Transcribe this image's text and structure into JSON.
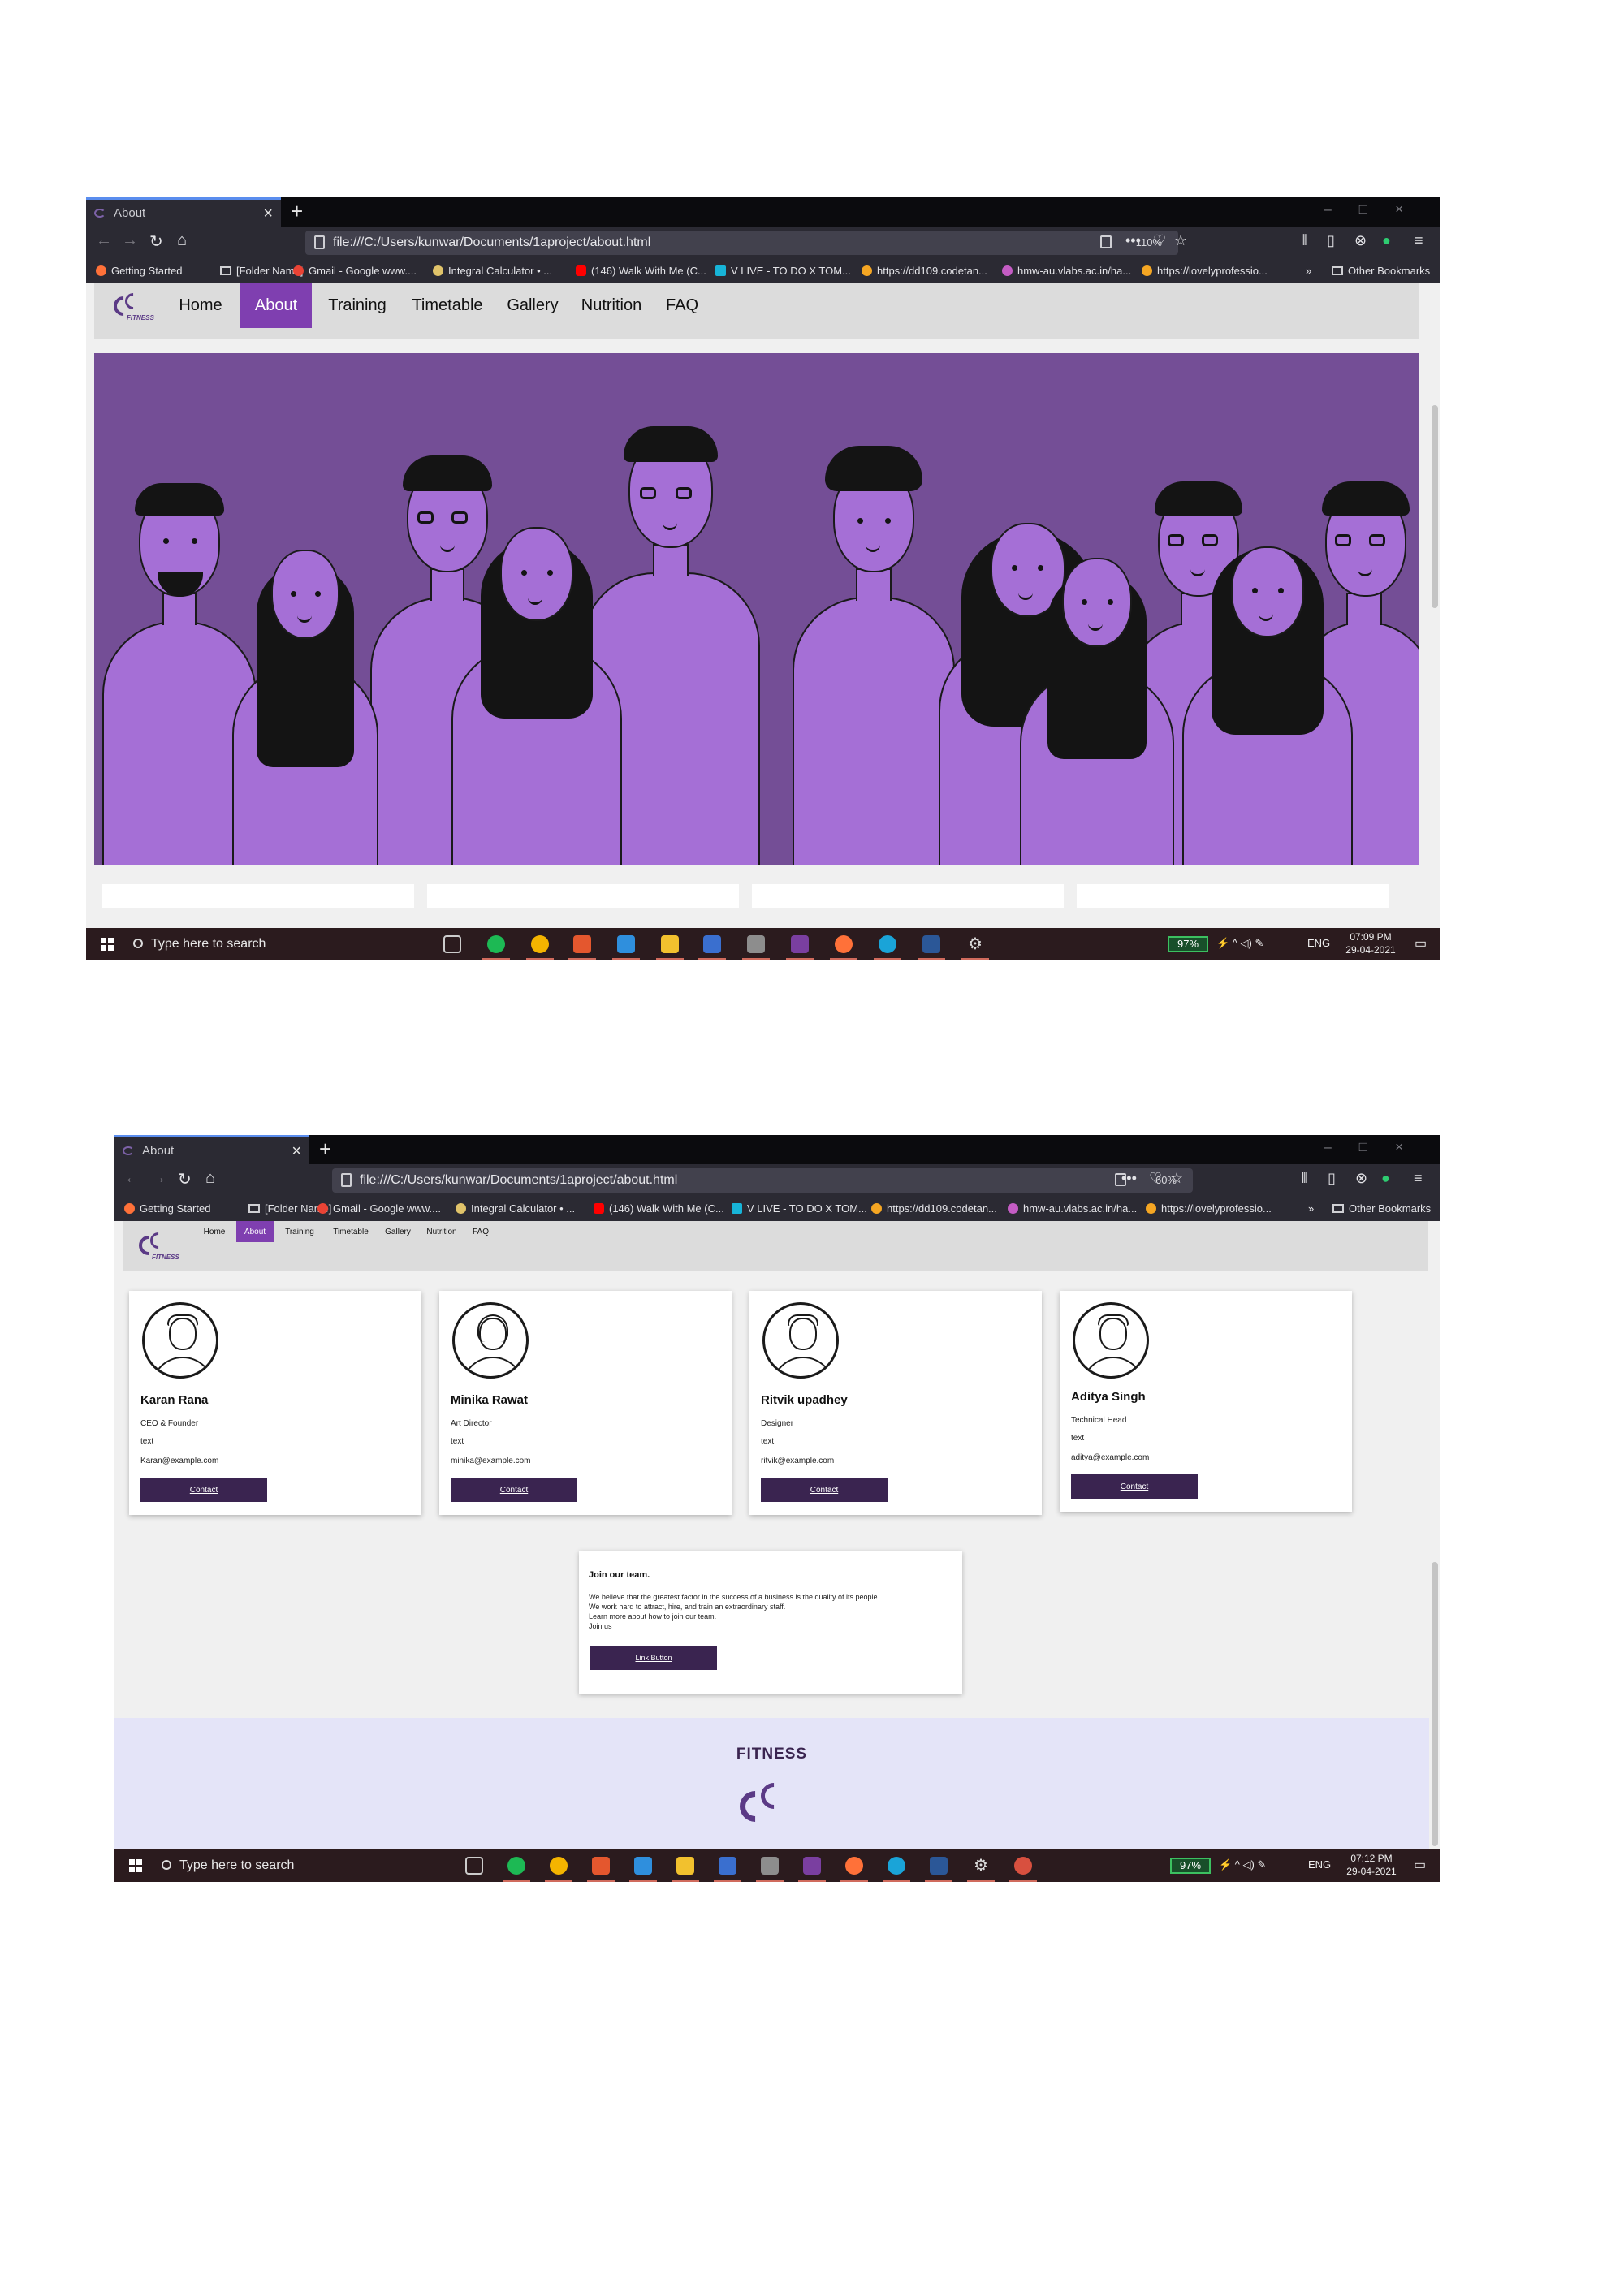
{
  "screens": [
    {
      "tab_title": "About",
      "url": "file:///C:/Users/kunwar/Documents/1aproject/about.html",
      "zoom": "110%",
      "time": "07:09 PM",
      "date": "29-04-2021"
    },
    {
      "tab_title": "About",
      "url": "file:///C:/Users/kunwar/Documents/1aproject/about.html",
      "zoom": "60%",
      "time": "07:12 PM",
      "date": "29-04-2021"
    }
  ],
  "bookmarks": [
    "Getting Started",
    "[Folder Name]",
    "Gmail - Google  www....",
    "Integral Calculator • ...",
    "(146) Walk With Me (C...",
    "V LIVE - TO DO X TOM...",
    "https://dd109.codetan...",
    "hmw-au.vlabs.ac.in/ha...",
    "https://lovelyprofessio...",
    "Other Bookmarks"
  ],
  "site": {
    "logo_text": "FITNESS",
    "nav": [
      "Home",
      "About",
      "Training",
      "Timetable",
      "Gallery",
      "Nutrition",
      "FAQ"
    ],
    "active_nav": "About"
  },
  "team": [
    {
      "name": "Karan Rana",
      "role": "CEO & Founder",
      "text": "text",
      "email": "Karan@example.com",
      "button": "Contact"
    },
    {
      "name": "Minika Rawat",
      "role": "Art Director",
      "text": "text",
      "email": "minika@example.com",
      "button": "Contact"
    },
    {
      "name": "Ritvik upadhey",
      "role": "Designer",
      "text": "text",
      "email": "ritvik@example.com",
      "button": "Contact"
    },
    {
      "name": "Aditya Singh",
      "role": "Technical Head",
      "text": "text",
      "email": "aditya@example.com",
      "button": "Contact"
    }
  ],
  "join": {
    "title": "Join our team.",
    "lines": [
      "We believe that the greatest factor in the success of a business is the quality of its people.",
      "We work hard to attract, hire, and train an extraordinary staff.",
      "Learn more about how to join our team.",
      "Join us"
    ],
    "button": "Link Button"
  },
  "footer": {
    "title": "FITNESS"
  },
  "taskbar": {
    "search_placeholder": "Type here to search",
    "battery": "97%",
    "lang": "ENG"
  },
  "colors": {
    "accent": "#7f3fb0",
    "hero_bg": "#744e96",
    "people": "#a56fd6",
    "button": "#3a2450",
    "footer_bg": "#e4e4f8"
  }
}
